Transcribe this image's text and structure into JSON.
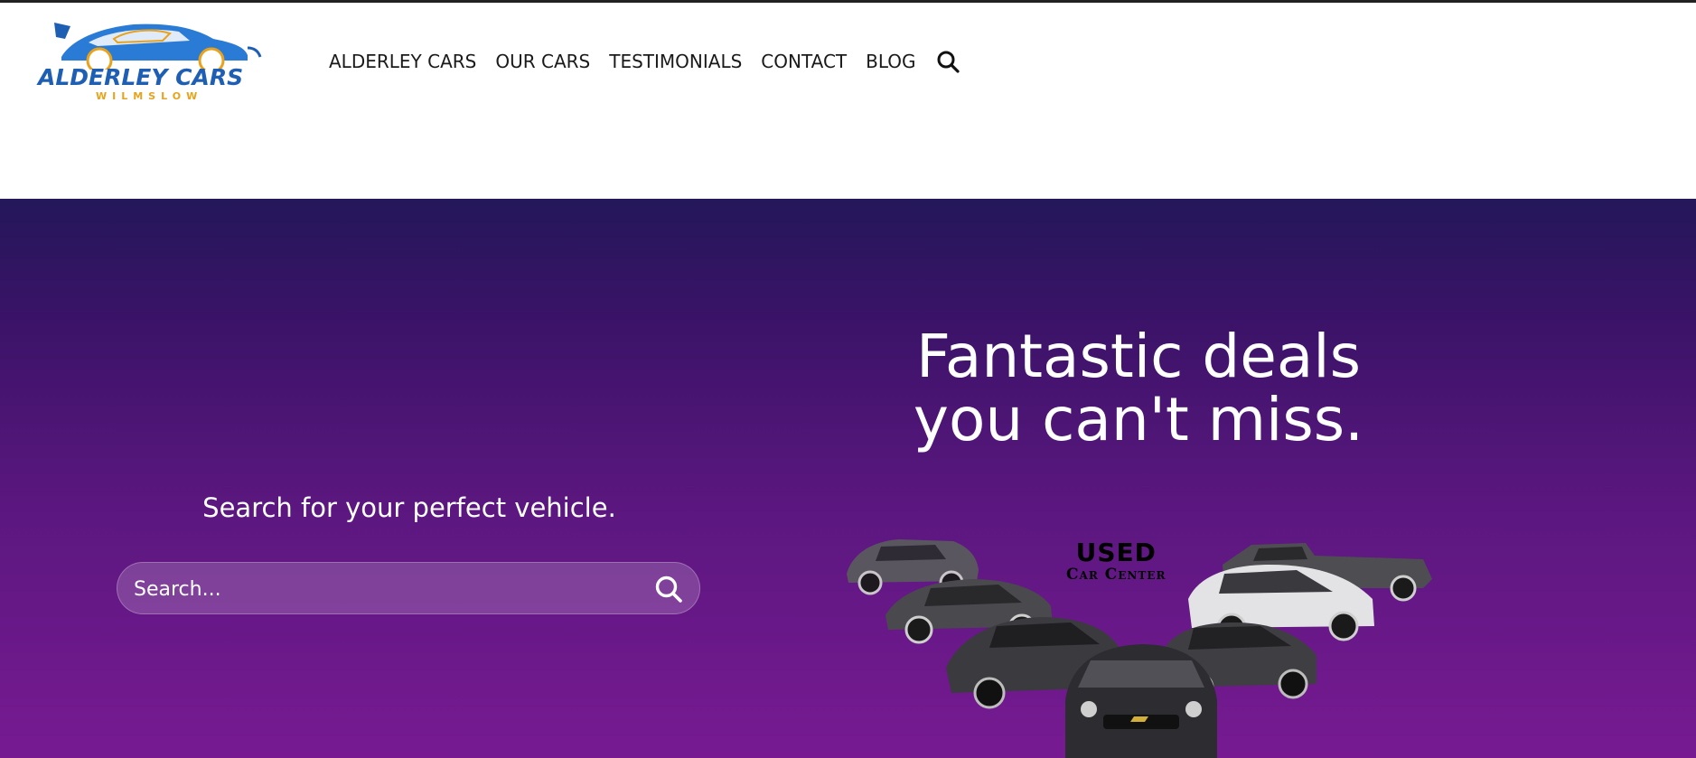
{
  "brand": {
    "name": "ALDERLEY CARS",
    "location": "WILMSLOW",
    "primary_color": "#1e5fb4",
    "accent_color": "#e8a21c"
  },
  "nav": {
    "items": [
      {
        "label": "ALDERLEY CARS"
      },
      {
        "label": "OUR CARS"
      },
      {
        "label": "TESTIMONIALS"
      },
      {
        "label": "CONTACT"
      },
      {
        "label": "BLOG"
      }
    ],
    "search_icon": "search-icon"
  },
  "hero": {
    "gradient_top": "#24175a",
    "gradient_bottom": "#771a92",
    "headline_line1": "Fantastic deals",
    "headline_line2": "you can't miss.",
    "subtitle": "Search for your perfect vehicle.",
    "search": {
      "placeholder": "Search...",
      "value": "",
      "icon": "search-icon"
    },
    "badge": {
      "main": "USED",
      "sub": "Car Center"
    }
  }
}
